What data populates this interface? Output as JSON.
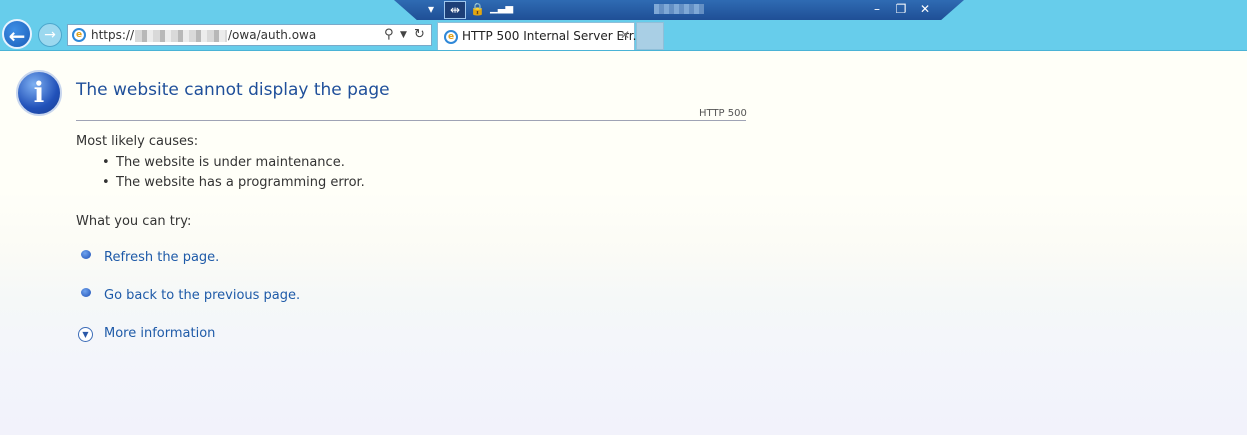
{
  "browser": {
    "address_prefix": "https://",
    "address_suffix": "/owa/auth.owa",
    "tab_title": "HTTP 500 Internal Server Err...",
    "tab_close": "✕"
  },
  "page": {
    "title": "The website cannot display the page",
    "status_code": "HTTP 500",
    "causes_heading": "Most likely causes:",
    "causes": [
      "The website is under maintenance.",
      "The website has a programming error."
    ],
    "try_heading": "What you can try:",
    "actions": [
      "Refresh the page.",
      "Go back to the previous page."
    ],
    "more_info": "More information"
  },
  "colors": {
    "chrome": "#67cdeb",
    "link": "#1e5aa8",
    "title": "#1f4f9a"
  }
}
